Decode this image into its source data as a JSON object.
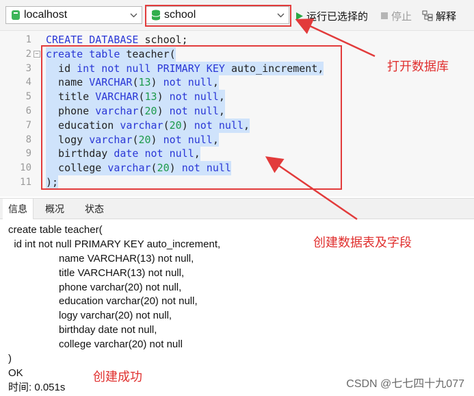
{
  "toolbar": {
    "connection": "localhost",
    "database": "school",
    "run_label": "运行已选择的",
    "stop_label": "停止",
    "explain_label": "解释"
  },
  "editor": {
    "lines": [
      {
        "n": "1",
        "tokens": [
          {
            "t": "CREATE DATABASE ",
            "c": "kw"
          },
          {
            "t": "school;",
            "c": ""
          }
        ]
      },
      {
        "n": "2",
        "tokens": [
          {
            "t": "create table ",
            "c": "kw"
          },
          {
            "t": "teacher(",
            "c": ""
          }
        ]
      },
      {
        "n": "3",
        "tokens": [
          {
            "t": "  id ",
            "c": ""
          },
          {
            "t": "int not null PRIMARY KEY ",
            "c": "kw"
          },
          {
            "t": "auto_increment,",
            "c": ""
          }
        ]
      },
      {
        "n": "4",
        "tokens": [
          {
            "t": "  name ",
            "c": ""
          },
          {
            "t": "VARCHAR",
            "c": "kw"
          },
          {
            "t": "(",
            "c": ""
          },
          {
            "t": "13",
            "c": "num"
          },
          {
            "t": ") ",
            "c": ""
          },
          {
            "t": "not null",
            "c": "kw"
          },
          {
            "t": ",",
            "c": ""
          }
        ]
      },
      {
        "n": "5",
        "tokens": [
          {
            "t": "  title ",
            "c": ""
          },
          {
            "t": "VARCHAR",
            "c": "kw"
          },
          {
            "t": "(",
            "c": ""
          },
          {
            "t": "13",
            "c": "num"
          },
          {
            "t": ") ",
            "c": ""
          },
          {
            "t": "not null",
            "c": "kw"
          },
          {
            "t": ",",
            "c": ""
          }
        ]
      },
      {
        "n": "6",
        "tokens": [
          {
            "t": "  phone ",
            "c": ""
          },
          {
            "t": "varchar",
            "c": "kw"
          },
          {
            "t": "(",
            "c": ""
          },
          {
            "t": "20",
            "c": "num"
          },
          {
            "t": ") ",
            "c": ""
          },
          {
            "t": "not null",
            "c": "kw"
          },
          {
            "t": ",",
            "c": ""
          }
        ]
      },
      {
        "n": "7",
        "tokens": [
          {
            "t": "  education ",
            "c": ""
          },
          {
            "t": "varchar",
            "c": "kw"
          },
          {
            "t": "(",
            "c": ""
          },
          {
            "t": "20",
            "c": "num"
          },
          {
            "t": ") ",
            "c": ""
          },
          {
            "t": "not null",
            "c": "kw"
          },
          {
            "t": ",",
            "c": ""
          }
        ]
      },
      {
        "n": "8",
        "tokens": [
          {
            "t": "  logy ",
            "c": ""
          },
          {
            "t": "varchar",
            "c": "kw"
          },
          {
            "t": "(",
            "c": ""
          },
          {
            "t": "20",
            "c": "num"
          },
          {
            "t": ") ",
            "c": ""
          },
          {
            "t": "not null",
            "c": "kw"
          },
          {
            "t": ",",
            "c": ""
          }
        ]
      },
      {
        "n": "9",
        "tokens": [
          {
            "t": "  birthday ",
            "c": ""
          },
          {
            "t": "date not null",
            "c": "kw"
          },
          {
            "t": ",",
            "c": ""
          }
        ]
      },
      {
        "n": "10",
        "tokens": [
          {
            "t": "  college ",
            "c": ""
          },
          {
            "t": "varchar",
            "c": "kw"
          },
          {
            "t": "(",
            "c": ""
          },
          {
            "t": "20",
            "c": "num"
          },
          {
            "t": ") ",
            "c": ""
          },
          {
            "t": "not null",
            "c": "kw"
          }
        ]
      },
      {
        "n": "11",
        "tokens": [
          {
            "t": ");",
            "c": ""
          }
        ]
      }
    ]
  },
  "tabs": {
    "info": "信息",
    "profile": "概况",
    "status": "状态"
  },
  "messages": {
    "lines": [
      "create table teacher(",
      "  id int not null PRIMARY KEY auto_increment,",
      "name VARCHAR(13) not null,",
      "title VARCHAR(13) not null,",
      "phone varchar(20) not null,",
      "education varchar(20) not null,",
      "logy varchar(20) not null,",
      "birthday date not null,",
      "college varchar(20) not null",
      ")",
      "OK",
      "时间: 0.051s"
    ]
  },
  "annotations": {
    "open_db": "打开数据库",
    "create_table": "创建数据表及字段",
    "success": "创建成功"
  },
  "watermark": "CSDN @七七四十九077",
  "colors": {
    "annotation": "#e0302f",
    "keyword": "#2a37d6",
    "number": "#1c9a4a",
    "selection": "#cfe3fb"
  }
}
